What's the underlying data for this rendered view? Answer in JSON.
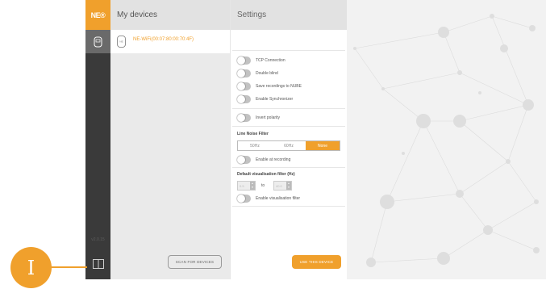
{
  "app": {
    "logo": "NE®",
    "version": "v2.0.15"
  },
  "devices": {
    "title": "My devices",
    "items": [
      {
        "name": "NE-WiFi(00:07:80:00:70:4F)",
        "icon": "device-icon"
      }
    ],
    "scan_label": "SCAN FOR DEVICES"
  },
  "settings": {
    "title": "Settings",
    "toggles": {
      "tcp": "TCP Connection",
      "double_blind": "Double blind",
      "save_nube": "Save recordings to NUBE",
      "sync": "Enable Synchronizer",
      "invert": "Invert polarity",
      "enable_recording": "Enable at recording",
      "enable_vis": "Enable visualisation filter"
    },
    "line_noise": {
      "title": "Line Noise Filter",
      "options": [
        "50Hz",
        "60Hz",
        "None"
      ],
      "selected": "None"
    },
    "vis_filter": {
      "title": "Default visualisation filter (Hz)",
      "from": "0.5",
      "to_label": "to",
      "to": "40.0"
    },
    "use_label": "USE THIS DEVICE"
  },
  "help": {
    "symbol": "I"
  },
  "colors": {
    "accent": "#f0a02c",
    "sidebar": "#3a3a3a",
    "panel": "#eaeaea"
  }
}
